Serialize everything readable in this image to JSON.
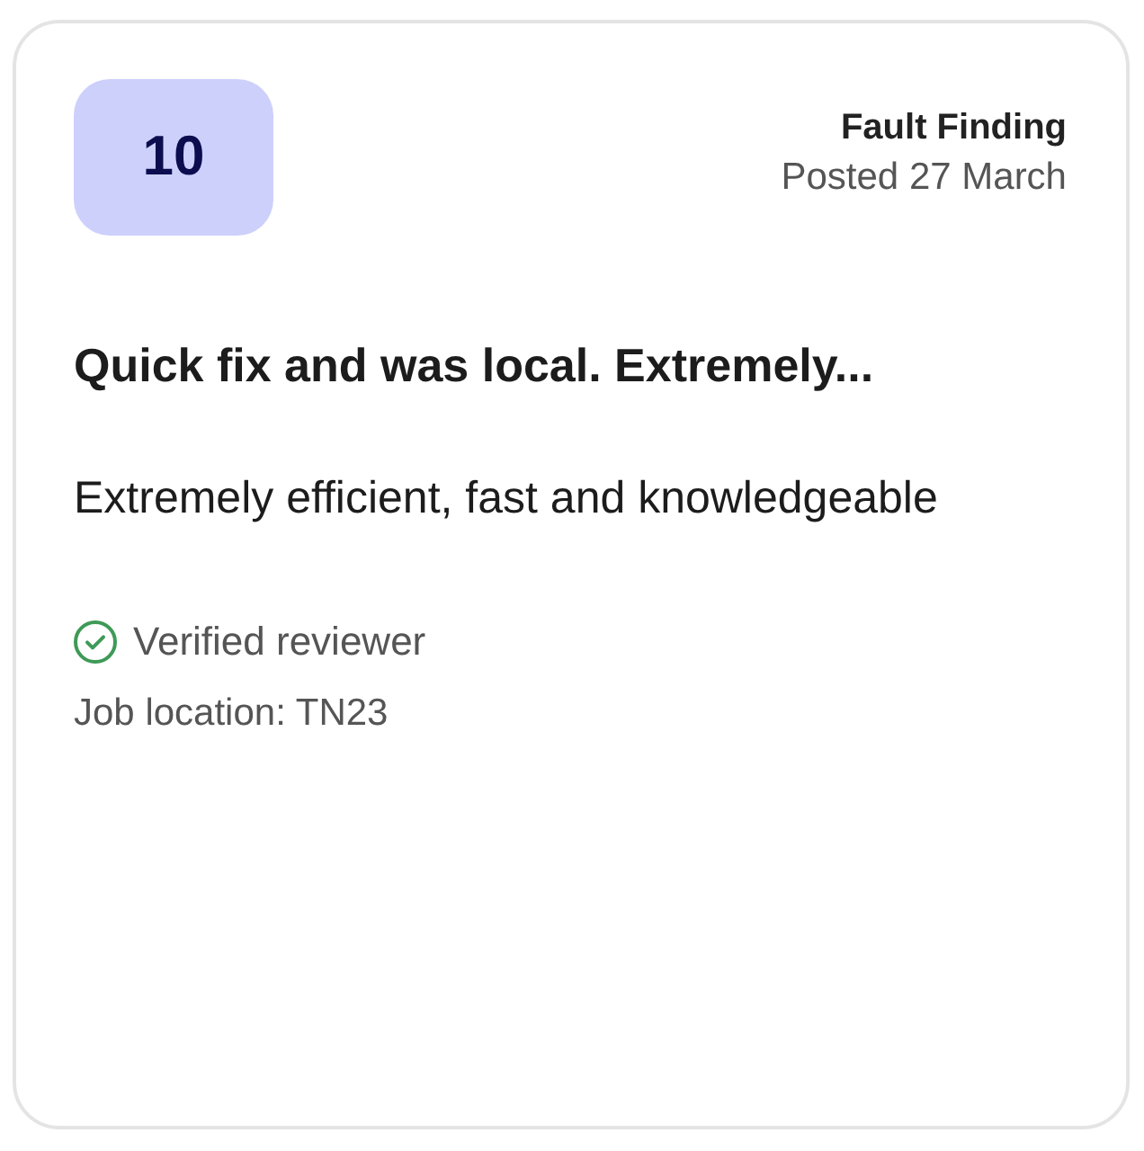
{
  "review": {
    "score": "10",
    "category": "Fault Finding",
    "posted": "Posted 27 March",
    "title": "Quick fix and was local. Extremely...",
    "body": "Extremely efficient, fast and knowledgeable",
    "verified": true,
    "verified_label": "Verified reviewer",
    "job_location": "Job location: TN23"
  }
}
